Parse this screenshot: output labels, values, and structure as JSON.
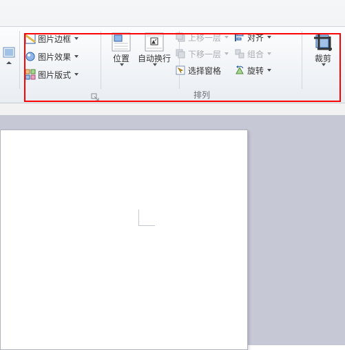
{
  "picture_styles": {
    "border": "图片边框",
    "effects": "图片效果",
    "layout": "图片版式"
  },
  "arrange": {
    "position": "位置",
    "wrap": "自动换行",
    "bring_forward": "上移一层",
    "send_backward": "下移一层",
    "selection_pane": "选择窗格",
    "align": "对齐",
    "group": "组合",
    "rotate": "旋转",
    "group_label": "排列"
  },
  "crop": {
    "label": "裁剪"
  }
}
